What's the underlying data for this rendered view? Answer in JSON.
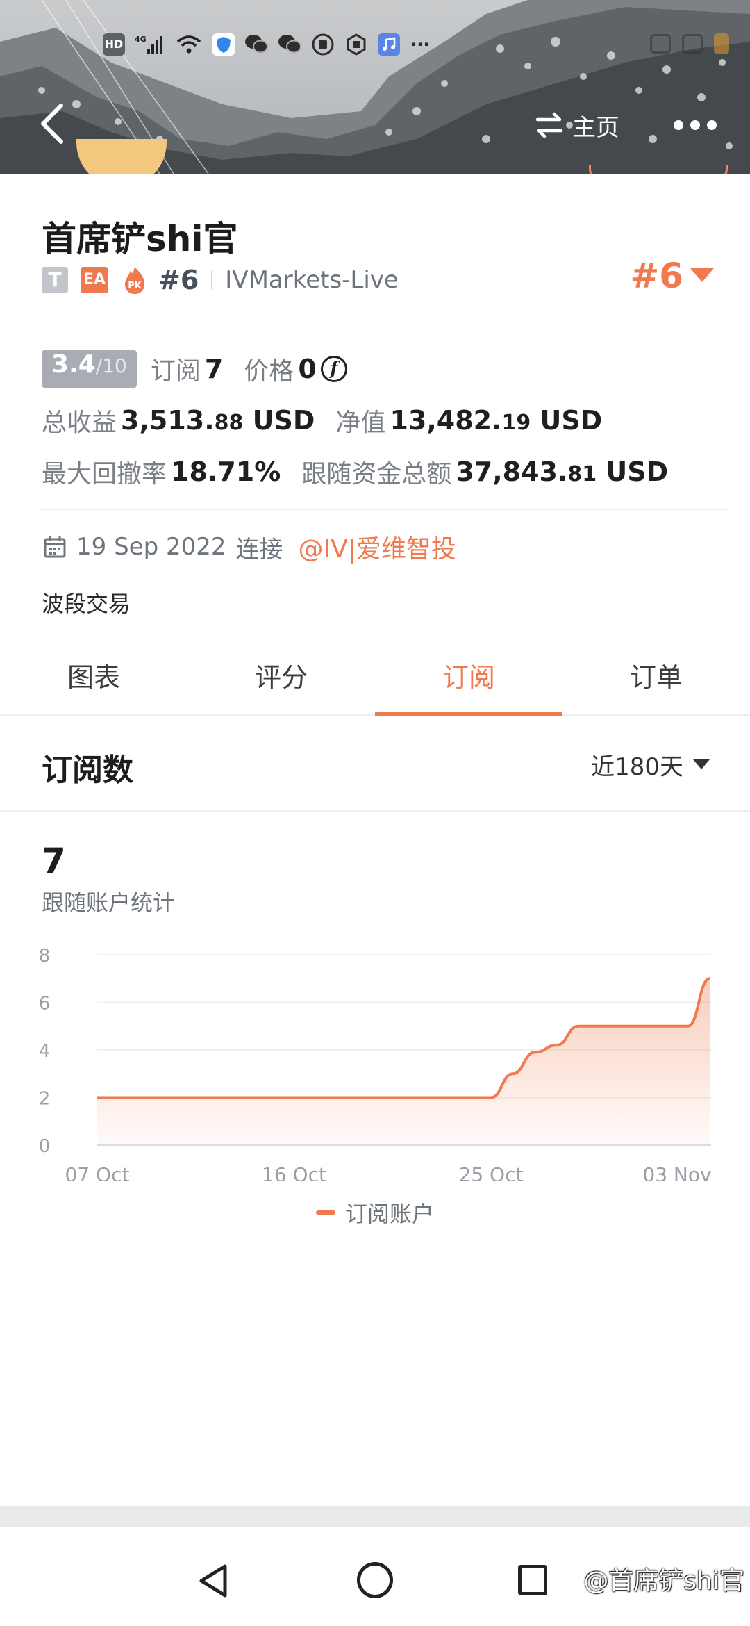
{
  "header": {
    "home_label": "主页",
    "status_icons": [
      "hd-icon",
      "4g-signal-icon",
      "wifi-icon",
      "shield-app-icon",
      "wechat-icon",
      "wechat-icon",
      "hand-app-icon",
      "hexagon-app-icon",
      "music-app-icon",
      "more-dots-icon"
    ],
    "status_hd": "HD",
    "status_net": "4G",
    "status_more": "···"
  },
  "profile": {
    "name": "首席铲shi官",
    "tag_t": "T",
    "tag_ea": "EA",
    "tag_pk": "PK",
    "rank": "#6",
    "broker": "IVMarkets-Live",
    "rank_right": "#6"
  },
  "stats": {
    "score": "3.4",
    "score_max": "/10",
    "subscribe_label": "订阅",
    "subscribe_value": "7",
    "price_label": "价格",
    "price_value": "0",
    "price_coin": "f",
    "total_profit_label": "总收益",
    "total_profit_int": "3,513.",
    "total_profit_dec": "88",
    "total_profit_unit": "USD",
    "net_value_label": "净值",
    "net_value_int": "13,482.",
    "net_value_dec": "19",
    "net_value_unit": "USD",
    "max_drawdown_label": "最大回撤率",
    "max_drawdown_value": "18.71%",
    "follow_funds_label": "跟随资金总额",
    "follow_funds_int": "37,843.",
    "follow_funds_dec": "81",
    "follow_funds_unit": "USD"
  },
  "connection": {
    "date": "19 Sep 2022",
    "verb": "连接",
    "handle": "@IV|爱维智投"
  },
  "description": "波段交易",
  "tabs": [
    {
      "label": "图表",
      "active": false
    },
    {
      "label": "评分",
      "active": false
    },
    {
      "label": "订阅",
      "active": true
    },
    {
      "label": "订单",
      "active": false
    }
  ],
  "subscriptions": {
    "title": "订阅数",
    "range": "近180天",
    "count": "7",
    "caption": "跟随账户统计"
  },
  "colors": {
    "accent": "#f07a4d",
    "text_secondary": "#6f757d"
  },
  "chart_data": {
    "type": "area",
    "title": "",
    "xlabel": "",
    "ylabel": "",
    "ylim": [
      0,
      8
    ],
    "yticks": [
      "0",
      "2",
      "4",
      "6",
      "8"
    ],
    "xticks": [
      "07 Oct",
      "16 Oct",
      "25 Oct",
      "03 Nov"
    ],
    "series": [
      {
        "name": "订阅账户",
        "x": [
          "07 Oct",
          "25 Oct",
          "26 Oct",
          "27 Oct",
          "28 Oct",
          "29 Oct",
          "03 Nov",
          "04 Nov"
        ],
        "values": [
          2,
          2,
          3,
          3.9,
          4.2,
          5,
          5,
          7
        ]
      }
    ],
    "grid": true,
    "legend": "bottom-center"
  },
  "watermark": "@首席铲shi官"
}
